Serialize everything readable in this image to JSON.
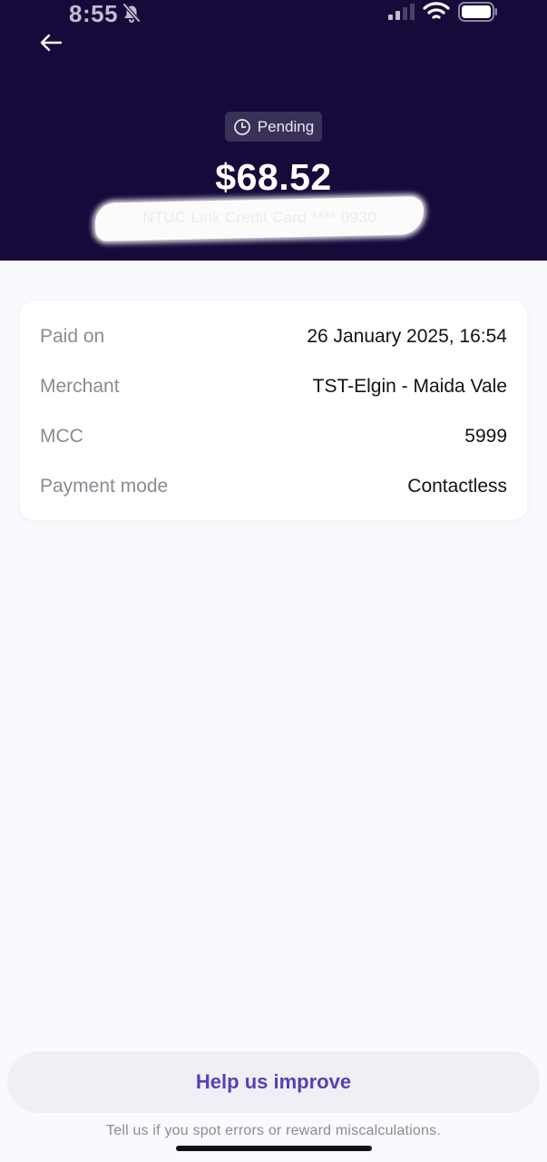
{
  "status_bar": {
    "time": "8:55"
  },
  "header": {
    "status_label": "Pending",
    "amount": "$68.52",
    "card_label": "NTUC Link Credit Card **** 0930"
  },
  "details": [
    {
      "label": "Paid on",
      "value": "26 January 2025, 16:54"
    },
    {
      "label": "Merchant",
      "value": "TST-Elgin - Maida Vale"
    },
    {
      "label": "MCC",
      "value": "5999"
    },
    {
      "label": "Payment mode",
      "value": "Contactless"
    }
  ],
  "feedback": {
    "button_label": "Help us improve",
    "subtitle": "Tell us if you spot errors or reward miscalculations."
  },
  "colors": {
    "header_bg": "#170a3b",
    "badge_bg": "#3a3158",
    "accent": "#5740b5",
    "page_bg": "#f9fafe"
  },
  "icons": [
    "bell-off-icon",
    "signal-icon",
    "wifi-icon",
    "battery-icon",
    "back-arrow-icon",
    "clock-icon"
  ]
}
